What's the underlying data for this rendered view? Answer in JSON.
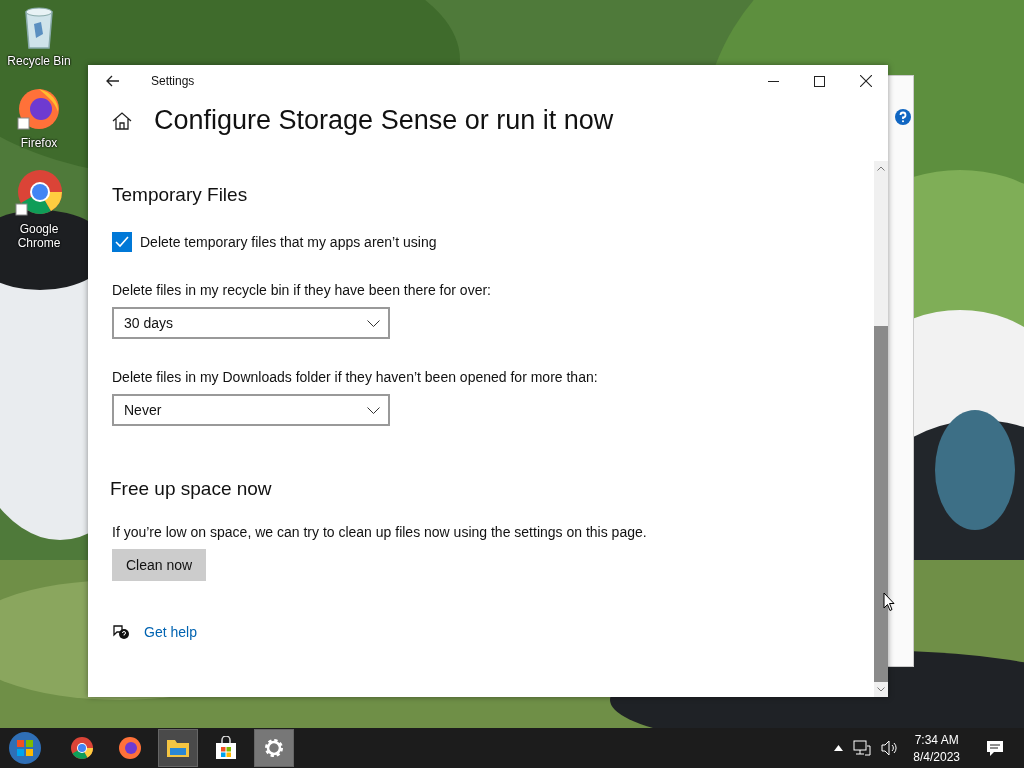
{
  "desktop_icons": [
    {
      "kind": "recycle",
      "label": "Recycle Bin",
      "shortcut": false
    },
    {
      "kind": "firefox",
      "label": "Firefox",
      "shortcut": true
    },
    {
      "kind": "chrome",
      "label": "Google Chrome",
      "shortcut": true
    }
  ],
  "window": {
    "title": "Settings",
    "heading": "Configure Storage Sense or run it now"
  },
  "temporary_files": {
    "title": "Temporary Files",
    "checkbox": {
      "label": "Delete temporary files that my apps aren’t using",
      "checked": true
    },
    "dropdowns": [
      {
        "label": "Delete files in my recycle bin if they have been there for over:",
        "value": "30 days"
      },
      {
        "label": "Delete files in my Downloads folder if they haven’t been opened for more than:",
        "value": "Never"
      }
    ]
  },
  "free_up": {
    "title": "Free up space now",
    "text": "If you’re low on space, we can try to clean up files now using the settings on this page.",
    "button": "Clean now"
  },
  "help_link": "Get help",
  "taskbar": {
    "items": [
      {
        "kind": "chrome",
        "open": false,
        "selected": false
      },
      {
        "kind": "firefox",
        "open": false,
        "selected": false
      },
      {
        "kind": "explorer",
        "open": true,
        "selected": false
      },
      {
        "kind": "store",
        "open": false,
        "selected": false
      },
      {
        "kind": "settings",
        "open": true,
        "selected": true
      }
    ],
    "time": "7:34 AM",
    "date": "8/4/2023"
  }
}
